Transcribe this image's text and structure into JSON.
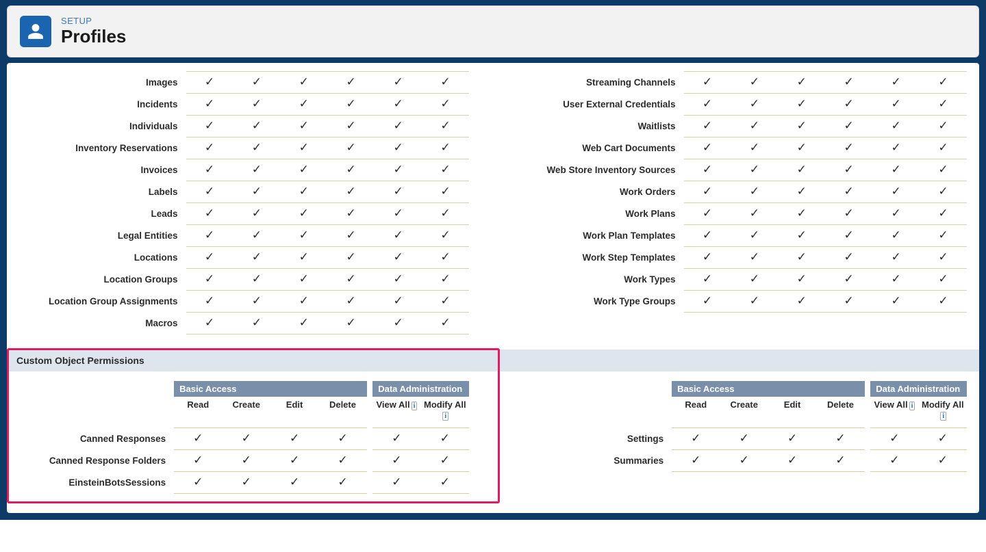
{
  "header": {
    "eyebrow": "SETUP",
    "title": "Profiles"
  },
  "check_glyph": "✓",
  "left_rows": [
    "Images",
    "Incidents",
    "Individuals",
    "Inventory Reservations",
    "Invoices",
    "Labels",
    "Leads",
    "Legal Entities",
    "Locations",
    "Location Groups",
    "Location Group Assignments",
    "Macros"
  ],
  "right_rows": [
    "Streaming Channels",
    "User External Credentials",
    "Waitlists",
    "Web Cart Documents",
    "Web Store Inventory Sources",
    "Work Orders",
    "Work Plans",
    "Work Plan Templates",
    "Work Step Templates",
    "Work Types",
    "Work Type Groups"
  ],
  "perm_cols": 6,
  "section_title": "Custom Object Permissions",
  "group_headers": {
    "basic": "Basic Access",
    "admin": "Data Administration"
  },
  "columns": {
    "read": "Read",
    "create": "Create",
    "edit": "Edit",
    "delete": "Delete",
    "view_all": "View All",
    "modify_all": "Modify All"
  },
  "info_char": "i",
  "custom_left": [
    "Canned Responses",
    "Canned Response Folders",
    "EinsteinBotsSessions"
  ],
  "custom_right": [
    "Settings",
    "Summaries"
  ]
}
